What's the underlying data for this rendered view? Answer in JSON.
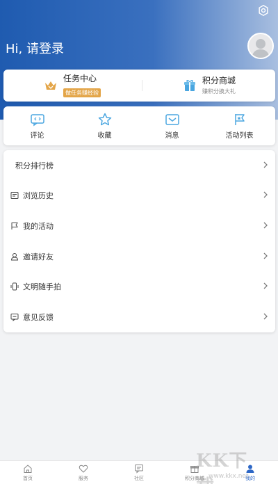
{
  "header": {
    "greeting": "Hi, 请登录"
  },
  "tasks": {
    "center": {
      "title": "任务中心",
      "tag": "做任务赚经验"
    },
    "mall": {
      "title": "积分商城",
      "subtitle": "赚积分换大礼"
    }
  },
  "shortcuts": [
    {
      "label": "评论",
      "icon": "comment-icon"
    },
    {
      "label": "收藏",
      "icon": "star-icon"
    },
    {
      "label": "消息",
      "icon": "message-icon"
    },
    {
      "label": "活动列表",
      "icon": "flag-icon"
    }
  ],
  "menu": [
    {
      "label": "积分排行榜",
      "icon": ""
    },
    {
      "label": "浏览历史",
      "icon": "history-icon"
    },
    {
      "label": "我的活动",
      "icon": "flag-icon"
    },
    {
      "label": "邀请好友",
      "icon": "user-icon"
    },
    {
      "label": "文明随手拍",
      "icon": "shake-icon"
    },
    {
      "label": "意见反馈",
      "icon": "feedback-icon"
    }
  ],
  "tabbar": [
    {
      "label": "首页",
      "icon": "home-icon"
    },
    {
      "label": "服务",
      "icon": "heart-icon"
    },
    {
      "label": "社区",
      "icon": "chat-icon"
    },
    {
      "label": "积分商城",
      "icon": "gift-icon"
    },
    {
      "label": "我的",
      "icon": "user-icon",
      "active": true
    }
  ],
  "watermark": {
    "text": "KK下载",
    "url": "www.kkx.net"
  },
  "colors": {
    "accent": "#2d67c6",
    "header_start": "#1f5bb0",
    "header_end": "#a9bfe0",
    "tag": "#e3a548",
    "icon_blue": "#4aa6e0"
  }
}
